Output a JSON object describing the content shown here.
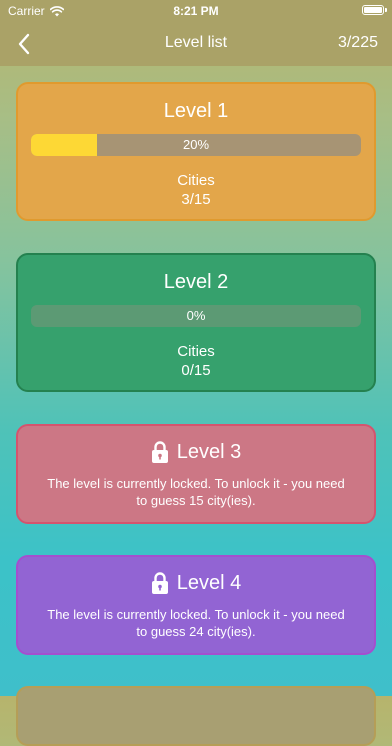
{
  "status_bar": {
    "carrier": "Carrier",
    "time": "8:21 PM"
  },
  "nav": {
    "title": "Level list",
    "count": "3/225",
    "back_icon": "chevron-left-icon"
  },
  "levels": [
    {
      "title": "Level 1",
      "progress_percent": 20,
      "progress_label": "20%",
      "cities_label": "Cities",
      "cities_count": "3/15",
      "color": "#e3a64a"
    },
    {
      "title": "Level 2",
      "progress_percent": 0,
      "progress_label": "0%",
      "cities_label": "Cities",
      "cities_count": "0/15",
      "color": "#36a16d"
    },
    {
      "title": "Level 3",
      "locked": true,
      "message": "The level is currently locked. To unlock it - you need to guess 15 city(ies).",
      "color": "#cc7785"
    },
    {
      "title": "Level 4",
      "locked": true,
      "message": "The level is currently locked. To unlock it - you need to guess 24 city(ies).",
      "color": "#9264d3"
    }
  ],
  "colors": {
    "nav_bar": "#aaa267",
    "progress_fill": "#fdd835"
  }
}
